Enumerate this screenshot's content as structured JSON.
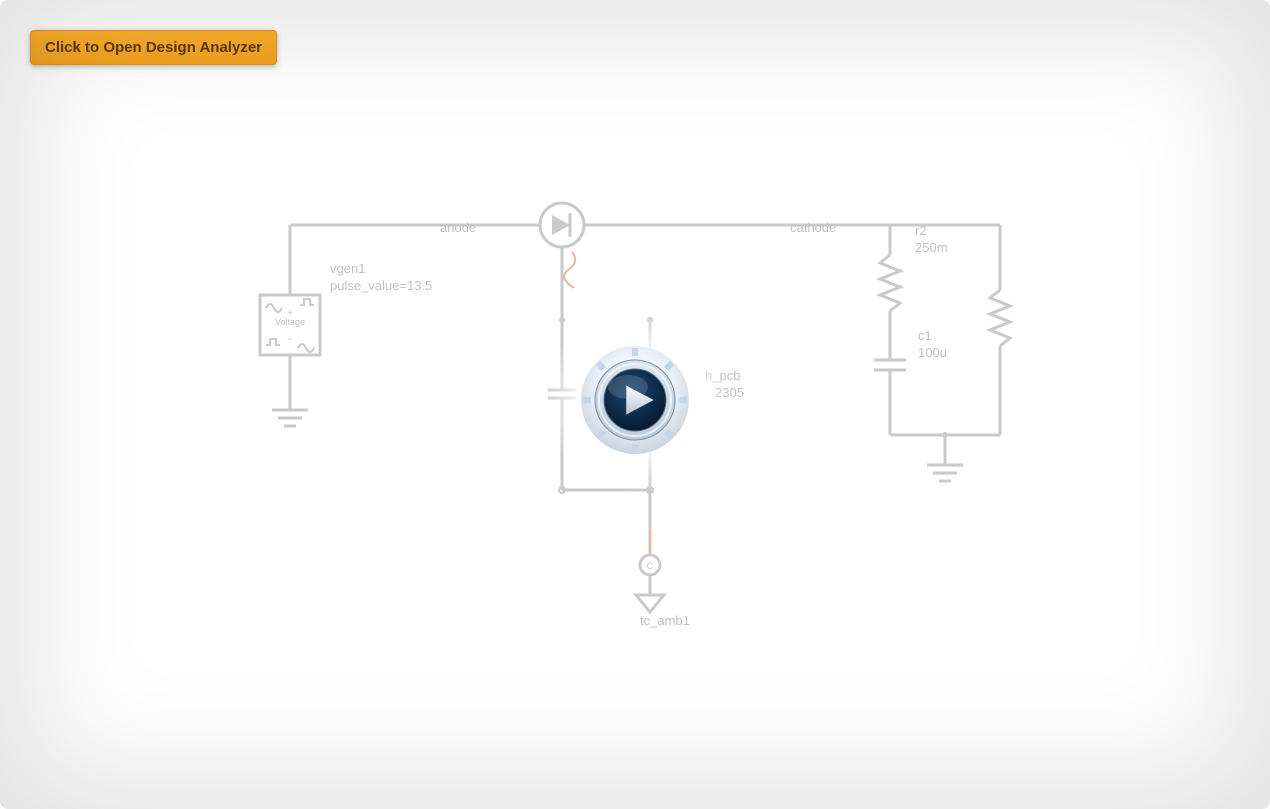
{
  "button": {
    "open_label": "Click to Open Design Analyzer"
  },
  "labels": {
    "anode": "anode",
    "cathode": "cathode",
    "vgen1": "vgen1",
    "pulse_value": "pulse_value=13.5",
    "voltage": "Voltage",
    "r2_name": "r2",
    "r2_value": "250m",
    "c1_name": "c1",
    "c1_value": "100u",
    "h_pcb": "h_pcb",
    "h_pcb_val": "2305",
    "tc_amb1": "tc_amb1",
    "c_symbol": "C"
  }
}
